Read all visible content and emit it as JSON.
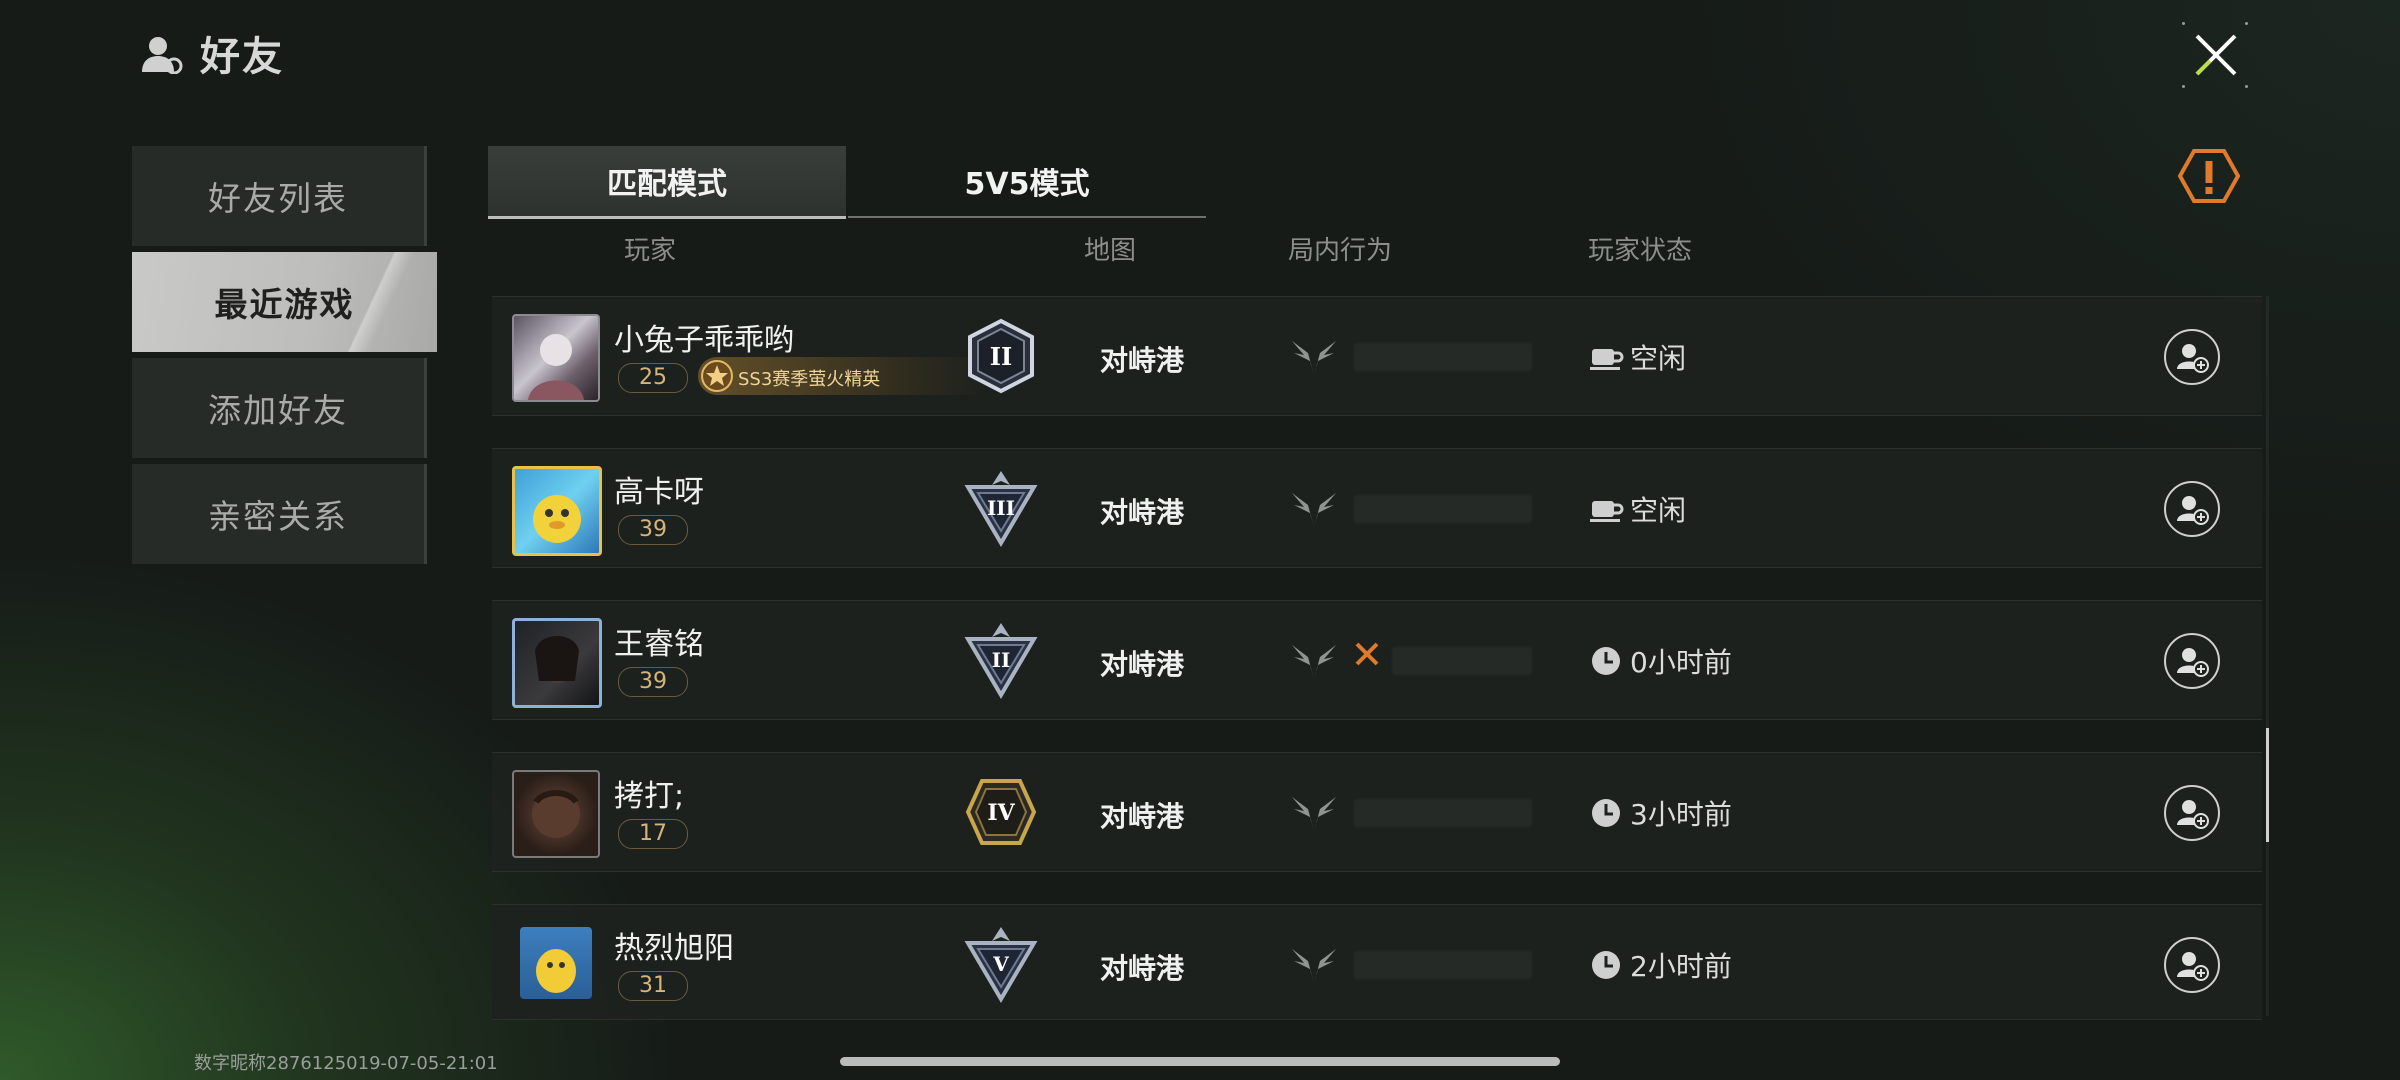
{
  "header": {
    "title": "好友"
  },
  "sidebar": {
    "items": [
      {
        "label": "好友列表",
        "active": false
      },
      {
        "label": "最近游戏",
        "active": true
      },
      {
        "label": "添加好友",
        "active": false
      },
      {
        "label": "亲密关系",
        "active": false
      }
    ]
  },
  "tabs": [
    {
      "label": "匹配模式",
      "active": true
    },
    {
      "label": "5V5模式",
      "active": false
    }
  ],
  "columns": {
    "player": "玩家",
    "map": "地图",
    "behavior": "局内行为",
    "status": "玩家状态"
  },
  "rows": [
    {
      "name": "小兔子乖乖哟",
      "level": "25",
      "season_badge": "SS3赛季萤火精英",
      "rank": "II",
      "map": "对峙港",
      "status_icon": "cup-icon",
      "status": "空闲"
    },
    {
      "name": "高卡呀",
      "level": "39",
      "rank": "III",
      "map": "对峙港",
      "status_icon": "cup-icon",
      "status": "空闲"
    },
    {
      "name": "王睿铭",
      "level": "39",
      "rank": "II",
      "map": "对峙港",
      "status_icon": "clock-icon",
      "status": "0小时前",
      "behavior_flag": "x"
    },
    {
      "name": "拷打;",
      "level": "17",
      "rank": "IV",
      "map": "对峙港",
      "status_icon": "clock-icon",
      "status": "3小时前"
    },
    {
      "name": "热烈旭阳",
      "level": "31",
      "rank": "V",
      "map": "对峙港",
      "status_icon": "clock-icon",
      "status": "2小时前"
    }
  ],
  "footer": {
    "watermark": "数字昵称2876125019-07-05-21:01"
  },
  "colors": {
    "accent_orange": "#e07a2c",
    "level_gold": "#d7b57a",
    "rank_gold": "#c9a64d",
    "rank_silver": "#aab3c2"
  }
}
